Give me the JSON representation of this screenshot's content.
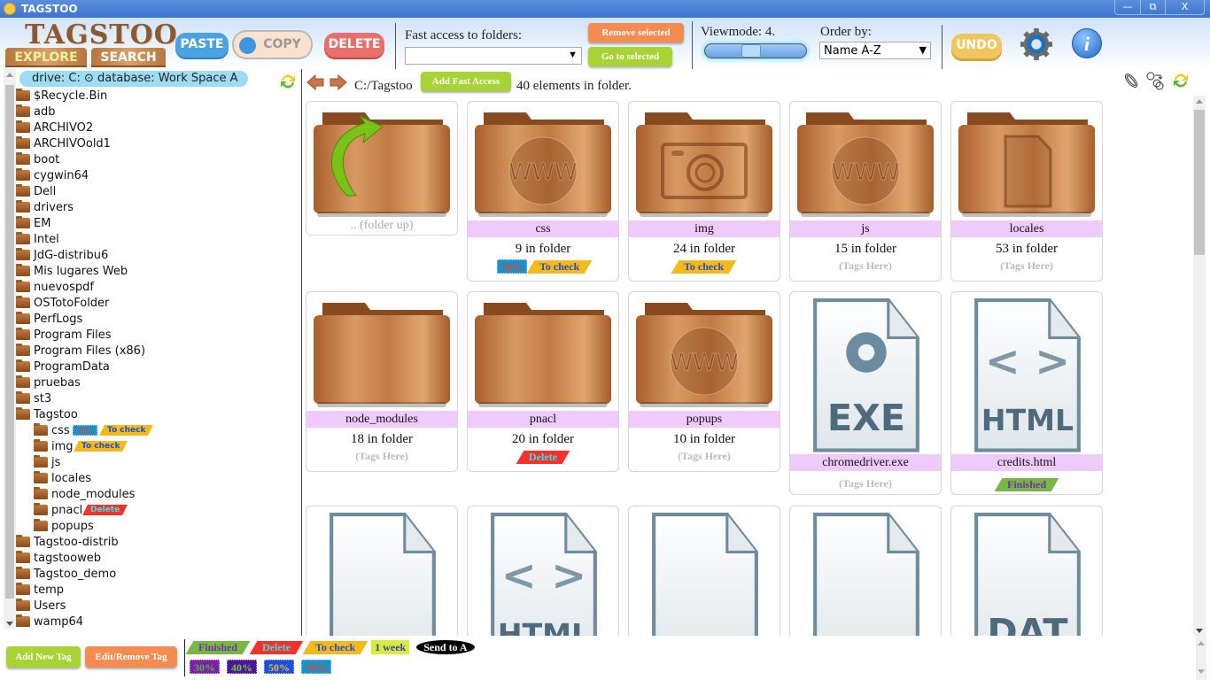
{
  "window": {
    "title": "TAGSTOO",
    "controls": {
      "minimize": "—",
      "restore": "⧉",
      "close": "X"
    }
  },
  "header": {
    "logo": "TAGSTOO",
    "tabs": [
      {
        "label": "EXPLORE",
        "active": true
      },
      {
        "label": "SEARCH",
        "active": false
      }
    ],
    "paste_label": "PASTE",
    "copy_label": "COPY",
    "delete_label": "DELETE",
    "fast_access": {
      "label": "Fast access to folders:",
      "selected": "",
      "remove_label": "Remove selected",
      "goto_label": "Go to selected"
    },
    "viewmode": {
      "label": "Viewmode: 4.",
      "value": 4,
      "fraction": 0.4
    },
    "order": {
      "label": "Order by:",
      "selected": "Name A-Z"
    },
    "undo_label": "UNDO",
    "settings_icon": "gear-icon",
    "info_icon": "info-icon"
  },
  "sidebar": {
    "drive_label": "drive: C: ⊙ database: Work Space A",
    "tree": [
      {
        "label": "$Recycle.Bin",
        "level": 0
      },
      {
        "label": "adb",
        "level": 0
      },
      {
        "label": "ARCHIVO2",
        "level": 0
      },
      {
        "label": "ARCHIVOold1",
        "level": 0
      },
      {
        "label": "boot",
        "level": 0
      },
      {
        "label": "cygwin64",
        "level": 0
      },
      {
        "label": "Dell",
        "level": 0
      },
      {
        "label": "drivers",
        "level": 0
      },
      {
        "label": "EM",
        "level": 0
      },
      {
        "label": "Intel",
        "level": 0
      },
      {
        "label": "JdG-distribu6",
        "level": 0
      },
      {
        "label": "Mis lugares Web",
        "level": 0
      },
      {
        "label": "nuevospdf",
        "level": 0
      },
      {
        "label": "OSTotoFolder",
        "level": 0
      },
      {
        "label": "PerfLogs",
        "level": 0
      },
      {
        "label": "Program Files",
        "level": 0
      },
      {
        "label": "Program Files (x86)",
        "level": 0
      },
      {
        "label": "ProgramData",
        "level": 0
      },
      {
        "label": "pruebas",
        "level": 0
      },
      {
        "label": "st3",
        "level": 0
      },
      {
        "label": "Tagstoo",
        "level": 0
      },
      {
        "label": "css",
        "level": 1,
        "tags": [
          "70%",
          "To check"
        ]
      },
      {
        "label": "img",
        "level": 1,
        "tags": [
          "To check"
        ]
      },
      {
        "label": "js",
        "level": 1
      },
      {
        "label": "locales",
        "level": 1
      },
      {
        "label": "node_modules",
        "level": 1
      },
      {
        "label": "pnacl",
        "level": 1,
        "tags": [
          "Delete"
        ]
      },
      {
        "label": "popups",
        "level": 1
      },
      {
        "label": "Tagstoo-distrib",
        "level": 0
      },
      {
        "label": "tagstooweb",
        "level": 0
      },
      {
        "label": "Tagstoo_demo",
        "level": 0
      },
      {
        "label": "temp",
        "level": 0
      },
      {
        "label": "Users",
        "level": 0
      },
      {
        "label": "wamp64",
        "level": 0
      }
    ]
  },
  "main": {
    "path": "C:/Tagstoo",
    "add_fast_access_label": "Add Fast Access",
    "count_text": "40 elements in folder.",
    "folder_up_label": ".. (folder up)",
    "tags_placeholder": "(Tags Here)",
    "items": [
      {
        "name": "css",
        "count": "9 in folder",
        "icon": "www",
        "type": "folder",
        "tags": [
          "70%",
          "To check"
        ]
      },
      {
        "name": "img",
        "count": "24 in folder",
        "icon": "camera",
        "type": "folder",
        "tags": [
          "To check"
        ]
      },
      {
        "name": "js",
        "count": "15 in folder",
        "icon": "www",
        "type": "folder",
        "tags": []
      },
      {
        "name": "locales",
        "count": "53 in folder",
        "icon": "document",
        "type": "folder",
        "tags": []
      },
      {
        "name": "node_modules",
        "count": "18 in folder",
        "icon": "plain",
        "type": "folder",
        "tags": []
      },
      {
        "name": "pnacl",
        "count": "20 in folder",
        "icon": "plain",
        "type": "folder",
        "tags": [
          "Delete"
        ]
      },
      {
        "name": "popups",
        "count": "10 in folder",
        "icon": "www",
        "type": "folder",
        "tags": []
      },
      {
        "name": "chromedriver.exe",
        "icon": "EXE",
        "type": "file",
        "tags": []
      },
      {
        "name": "credits.html",
        "icon": "HTML",
        "type": "file",
        "tags": [
          "Finished"
        ]
      },
      {
        "name": "",
        "icon": "",
        "type": "file",
        "tags": []
      },
      {
        "name": "",
        "icon": "HTML",
        "type": "file",
        "tags": []
      },
      {
        "name": "",
        "icon": "",
        "type": "file",
        "tags": []
      },
      {
        "name": "",
        "icon": "",
        "type": "file",
        "tags": []
      },
      {
        "name": "",
        "icon": "DAT",
        "type": "file",
        "tags": []
      }
    ]
  },
  "tag_defs": {
    "Finished": {
      "bg": "#76b843",
      "fg": "#7a2db0",
      "shape": "parallelogram"
    },
    "Delete": {
      "bg": "#f3332a",
      "fg": "#35e0f0",
      "shape": "parallelogram"
    },
    "To check": {
      "bg": "#f5b91a",
      "fg": "#1d4fd6",
      "shape": "parallelogram"
    },
    "1 week": {
      "bg": "#d6ec3a",
      "fg": "#3b3ab8",
      "shape": "box"
    },
    "Send to A": {
      "bg": "#000000",
      "fg": "#ffffff",
      "shape": "ellipse"
    },
    "30%": {
      "bg": "#7e1fa8",
      "fg": "#49b83c",
      "shape": "stamp"
    },
    "40%": {
      "bg": "#4a179c",
      "fg": "#7ac43a",
      "shape": "stamp"
    },
    "50%": {
      "bg": "#1c4fe0",
      "fg": "#f7b624",
      "shape": "stamp"
    },
    "70%": {
      "bg": "#1a90cc",
      "fg": "#e0471f",
      "shape": "stamp"
    }
  },
  "footer": {
    "add_tag_label": "Add New Tag",
    "edit_tag_label": "Edit/Remove Tag",
    "row1": [
      "Finished",
      "Delete",
      "To check",
      "1 week",
      "Send to A"
    ],
    "row2": [
      "30%",
      "40%",
      "50%",
      "70%"
    ]
  }
}
